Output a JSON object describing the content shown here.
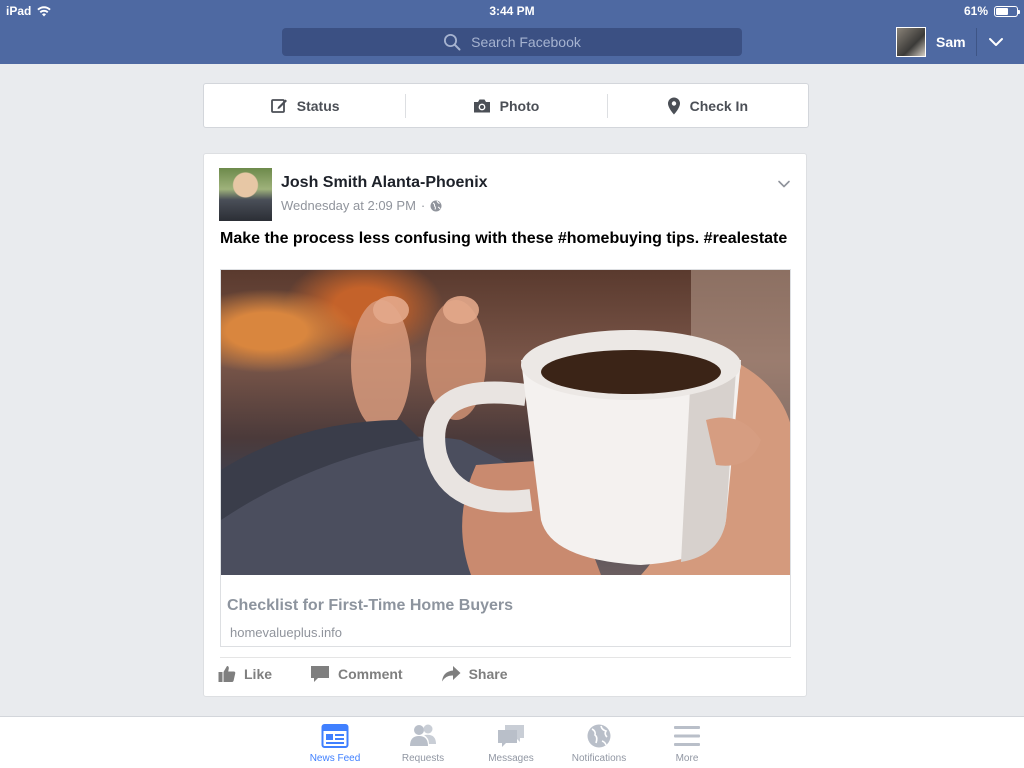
{
  "status_bar": {
    "device": "iPad",
    "time": "3:44 PM",
    "battery": "61%",
    "battery_level": 0.61
  },
  "header": {
    "search_placeholder": "Search Facebook",
    "user_name": "Sam"
  },
  "composer": {
    "status_label": "Status",
    "photo_label": "Photo",
    "checkin_label": "Check In"
  },
  "post": {
    "author": "Josh Smith Alanta-Phoenix",
    "timestamp": "Wednesday at 2:09 PM",
    "separator": "·",
    "text": "Make the process less confusing with these #homebuying tips. #realestate",
    "link": {
      "title": "Checklist for First-Time Home Buyers",
      "domain": "homevalueplus.info"
    },
    "actions": {
      "like": "Like",
      "comment": "Comment",
      "share": "Share"
    }
  },
  "tabs": [
    {
      "label": "News Feed",
      "icon": "news-feed-icon",
      "active": true
    },
    {
      "label": "Requests",
      "icon": "friend-requests-icon",
      "active": false
    },
    {
      "label": "Messages",
      "icon": "messages-icon",
      "active": false
    },
    {
      "label": "Notifications",
      "icon": "globe-icon",
      "active": false
    },
    {
      "label": "More",
      "icon": "menu-icon",
      "active": false
    }
  ],
  "colors": {
    "brand_blue": "#4e69a2",
    "active_tab": "#4080ff",
    "inactive_tab": "#9197a3"
  }
}
